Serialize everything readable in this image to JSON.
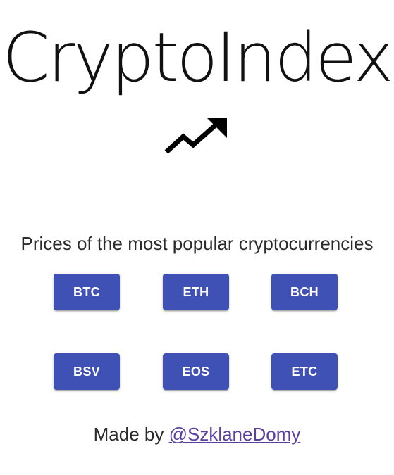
{
  "app": {
    "title": "CryptoIndex",
    "logo_icon": "trending-up-icon"
  },
  "main": {
    "subtitle": "Prices of the most popular cryptocurrencies",
    "coins": [
      {
        "label": "BTC"
      },
      {
        "label": "ETH"
      },
      {
        "label": "BCH"
      },
      {
        "label": "BSV"
      },
      {
        "label": "EOS"
      },
      {
        "label": "ETC"
      }
    ]
  },
  "footer": {
    "made_by": "Made by",
    "author_link": "@SzklaneDomy"
  },
  "colors": {
    "button_bg": "#3f51b5",
    "button_text": "#ffffff",
    "link": "#5b3fa0",
    "text": "#222222"
  }
}
